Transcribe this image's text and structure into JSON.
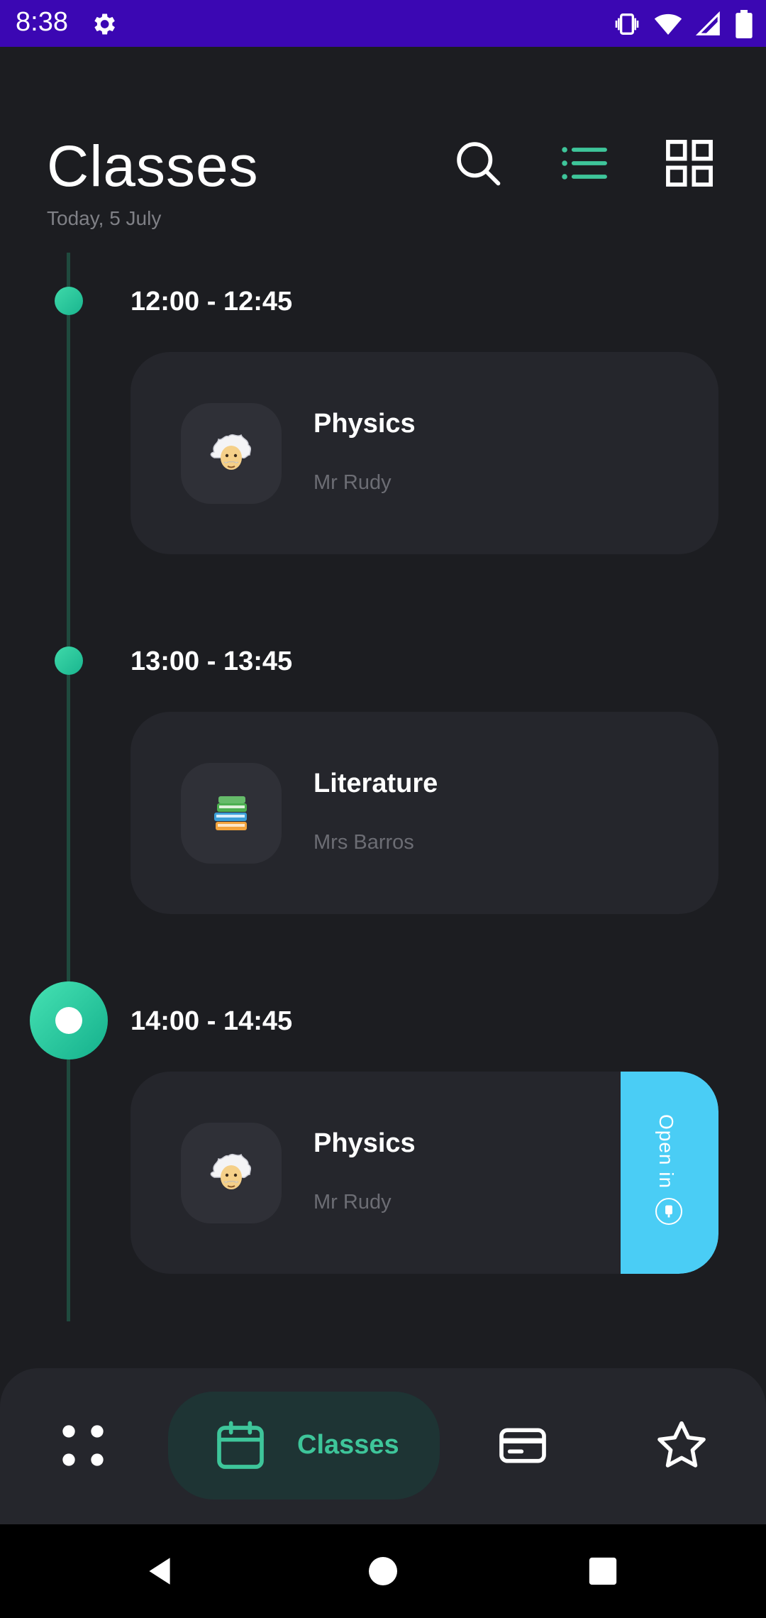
{
  "status_bar": {
    "time": "8:38",
    "icons": [
      "gear-icon",
      "vibrate-icon",
      "wifi-icon",
      "signal-icon",
      "battery-icon"
    ]
  },
  "header": {
    "title": "Classes",
    "date": "Today, 5 July",
    "actions": [
      "search-icon",
      "list-view-icon",
      "grid-view-icon"
    ]
  },
  "timeline": [
    {
      "time": "12:00 - 12:45",
      "subject": "Physics",
      "teacher": "Mr Rudy",
      "icon": "einstein-emoji",
      "current": false
    },
    {
      "time": "13:00 - 13:45",
      "subject": "Literature",
      "teacher": "Mrs Barros",
      "icon": "books-emoji",
      "current": false
    },
    {
      "time": "14:00 - 14:45",
      "subject": "Physics",
      "teacher": "Mr Rudy",
      "icon": "einstein-emoji",
      "current": true,
      "action_label": "Open in"
    }
  ],
  "bottom_nav": {
    "items": [
      {
        "name": "dashboard",
        "icon": "dots-grid-icon"
      },
      {
        "name": "classes",
        "icon": "calendar-icon",
        "label": "Classes",
        "active": true
      },
      {
        "name": "payments",
        "icon": "card-icon"
      },
      {
        "name": "favorites",
        "icon": "star-icon"
      }
    ]
  },
  "colors": {
    "background": "#1c1d21",
    "card": "#25262c",
    "accent": "#3ec59a",
    "status_bar": "#3b07b3",
    "open_in": "#4acdf5"
  }
}
